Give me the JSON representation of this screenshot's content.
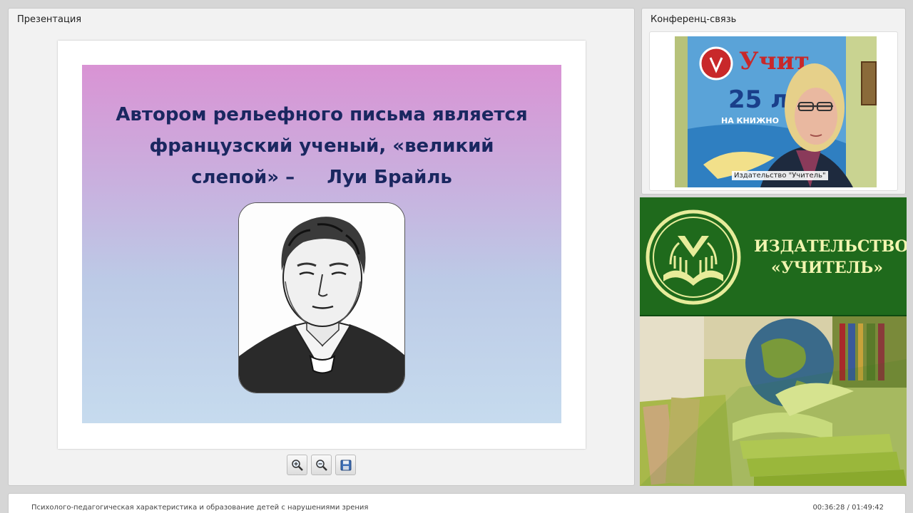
{
  "presentation": {
    "title": "Презентация",
    "slide": {
      "heading_lines": [
        "Автором рельефного письма является",
        "французский ученый, «великий",
        "слепой» –     Луи Брайль"
      ]
    },
    "toolbar": {
      "zoom_in_icon": "zoom-in-icon",
      "zoom_out_icon": "zoom-out-icon",
      "save_icon": "save-icon"
    }
  },
  "conference": {
    "title": "Конференц-связь",
    "participant_label": "Издательство \"Учитель\""
  },
  "banner": {
    "line1": "ИЗДАТЕЛЬСТВО",
    "line2": "«УЧИТЕЛЬ»",
    "colors": {
      "background": "#1f6a1c",
      "text": "#f2f5b0"
    }
  },
  "footer": {
    "course_title": "Психолого-педагогическая характеристика и образование детей с нарушениями зрения",
    "time": "00:36:28 / 01:49:42"
  }
}
